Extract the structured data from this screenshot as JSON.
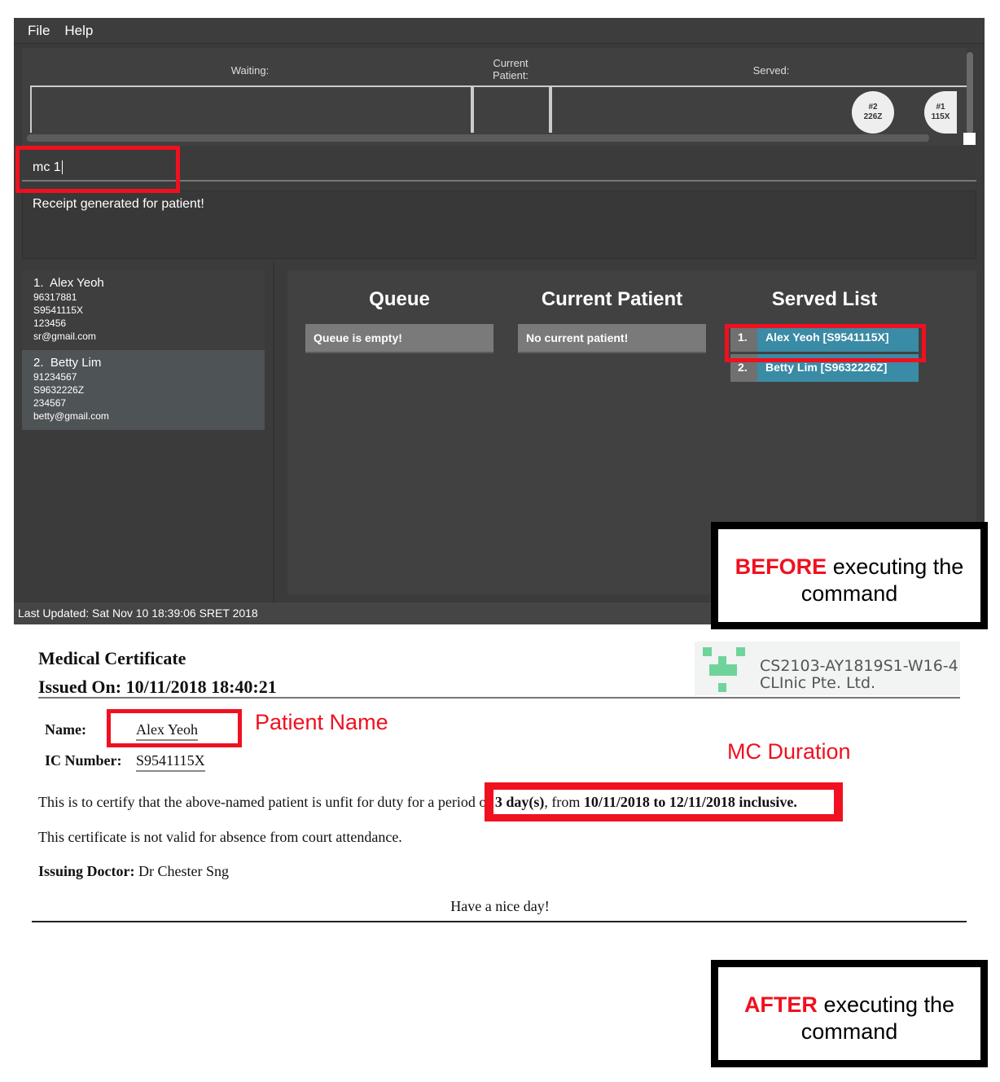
{
  "menu": {
    "file": "File",
    "help": "Help"
  },
  "top_panel": {
    "waiting_label": "Waiting:",
    "current_label": "Current Patient:",
    "served_label": "Served:",
    "served_tickets": [
      {
        "number": "#2",
        "code": "226Z"
      },
      {
        "number": "#1",
        "code": "115X"
      }
    ]
  },
  "command": {
    "value": "mc 1"
  },
  "result": {
    "text": "Receipt generated for patient!"
  },
  "patients": [
    {
      "index": "1.",
      "name": "Alex Yeoh",
      "phone": "96317881",
      "ic": "S9541115X",
      "address": "123456",
      "email": "sr@gmail.com"
    },
    {
      "index": "2.",
      "name": "Betty Lim",
      "phone": "91234567",
      "ic": "S9632226Z",
      "address": "234567",
      "email": "betty@gmail.com"
    }
  ],
  "queue_panel": {
    "queue_title": "Queue",
    "queue_empty": "Queue is empty!",
    "current_title": "Current Patient",
    "current_empty": "No current patient!",
    "served_title": "Served List",
    "served": [
      {
        "index": "1.",
        "label": "Alex Yeoh [S9541115X]"
      },
      {
        "index": "2.",
        "label": "Betty Lim [S9632226Z]"
      }
    ]
  },
  "status_bar": {
    "text": "Last Updated: Sat Nov 10 18:39:06 SRET 2018"
  },
  "annotations": {
    "before_bold": "BEFORE",
    "before_rest": " executing the command",
    "after_bold": "AFTER",
    "after_rest": " executing the command",
    "patient_name": "Patient Name",
    "mc_duration": "MC Duration"
  },
  "certificate": {
    "title": "Medical Certificate",
    "issued_on": "Issued On: 10/11/2018 18:40:21",
    "clinic_line1": "CS2103-AY1819S1-W16-4",
    "clinic_line2": "CLInic Pte. Ltd.",
    "name_label": "Name:",
    "name_value": "Alex Yeoh",
    "ic_label": "IC Number:",
    "ic_value": "S9541115X",
    "certify_text": "This is to certify that the above-named patient is unfit for duty for a period ",
    "certify_of": "of ",
    "certify_days": "3 day(s)",
    "certify_from": ", from ",
    "certify_range": "10/11/2018 to 12/11/2018 inclusive.",
    "court_text": "This certificate is not valid for absence from court attendance.",
    "doctor_label": "Issuing Doctor:",
    "doctor_name": " Dr Chester Sng",
    "closing": "Have a nice day!"
  },
  "colors": {
    "accent_red": "#f0101f",
    "served_blue": "#3a8ba5",
    "logo_green": "#6fd49a"
  }
}
